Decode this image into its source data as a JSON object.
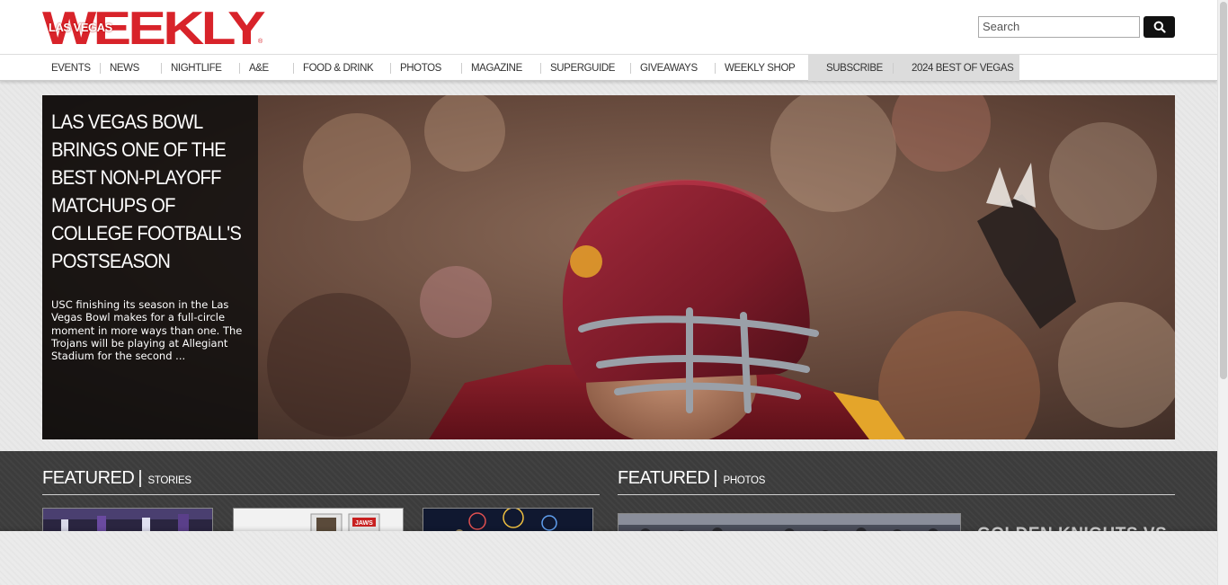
{
  "brand": {
    "logo_small": "LAS VEGAS",
    "logo_main": "WEEKLY",
    "accent_color": "#d8232a"
  },
  "search": {
    "placeholder": "Search",
    "icon": "search-icon"
  },
  "nav": {
    "items": [
      {
        "label": "EVENTS"
      },
      {
        "label": "NEWS"
      },
      {
        "label": "NIGHTLIFE"
      },
      {
        "label": "A&E"
      },
      {
        "label": "FOOD & DRINK"
      },
      {
        "label": "PHOTOS"
      },
      {
        "label": "MAGAZINE"
      },
      {
        "label": "SUPERGUIDE"
      },
      {
        "label": "GIVEAWAYS"
      },
      {
        "label": "WEEKLY SHOP"
      },
      {
        "label": "SUBSCRIBE"
      },
      {
        "label": "2024 BEST OF VEGAS"
      }
    ]
  },
  "hero": {
    "title": "LAS VEGAS BOWL BRINGS ONE OF THE BEST NON-PLAYOFF MATCHUPS OF COLLEGE FOOTBALL'S POSTSEASON",
    "summary": "USC finishing its season in the Las Vegas Bowl makes for a full-circle moment in more ways than one. The Trojans will be playing at Allegiant Stadium for the second ..."
  },
  "featured_stories": {
    "title": "FEATURED",
    "subtitle": "STORIES"
  },
  "featured_photos": {
    "title": "FEATURED",
    "subtitle": "PHOTOS",
    "caption": "GOLDEN KNIGHTS VS"
  }
}
